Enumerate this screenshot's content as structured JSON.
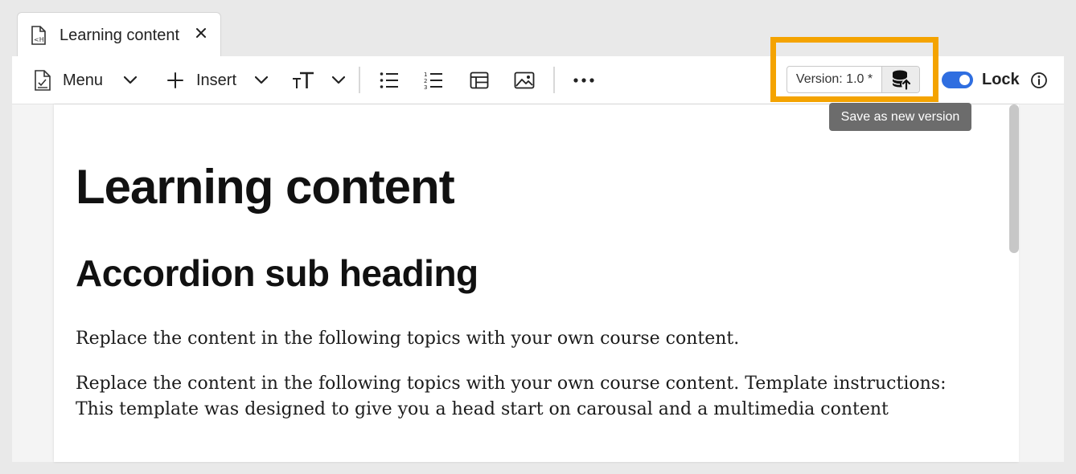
{
  "tab": {
    "icon": "html-file-icon",
    "label": "Learning content",
    "close_icon": "close-icon"
  },
  "toolbar": {
    "menu_label": "Menu",
    "insert_label": "Insert",
    "icons": [
      "document-check-icon",
      "chevron-down-icon",
      "plus-icon",
      "text-size-icon",
      "bulleted-list-icon",
      "numbered-list-icon",
      "table-icon",
      "image-icon",
      "more-icon",
      "save-version-icon",
      "info-icon"
    ],
    "version_label": "Version: 1.0 *",
    "lock_label": "Lock",
    "lock_on": true
  },
  "tooltip": {
    "text": "Save as new version"
  },
  "document": {
    "title": "Learning content",
    "subheading": "Accordion sub heading",
    "paragraphs": [
      "Replace the content in the following topics with your own course content.",
      "Replace the content in the following topics with your own course content. Template instructions: This template was designed to give you a head start on carousal and a multimedia content"
    ]
  },
  "colors": {
    "accent": "#2f6ee0",
    "highlight": "#f4a300",
    "tooltip_bg": "#6c6c6c"
  }
}
